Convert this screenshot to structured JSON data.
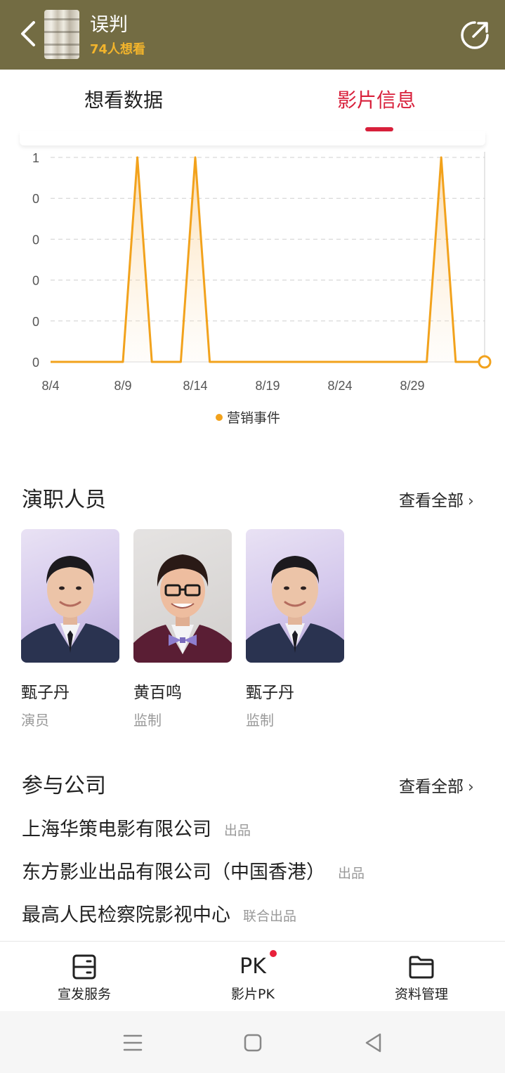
{
  "header": {
    "title": "误判",
    "subtitle": "74人想看",
    "back_icon": "chevron-left-icon",
    "share_icon": "share-icon"
  },
  "tabs": [
    {
      "label": "想看数据",
      "active": false
    },
    {
      "label": "影片信息",
      "active": true
    }
  ],
  "colors": {
    "header_bg": "#736c43",
    "accent": "#d8203b",
    "line": "#f2a21c",
    "subtitle": "#f2b42c"
  },
  "chart_data": {
    "type": "area",
    "x": [
      "8/4",
      "8/5",
      "8/6",
      "8/7",
      "8/8",
      "8/9",
      "8/10",
      "8/11",
      "8/12",
      "8/13",
      "8/14",
      "8/15",
      "8/16",
      "8/17",
      "8/18",
      "8/19",
      "8/20",
      "8/21",
      "8/22",
      "8/23",
      "8/24",
      "8/25",
      "8/26",
      "8/27",
      "8/28",
      "8/29",
      "8/30",
      "8/31",
      "9/1",
      "9/2",
      "9/3"
    ],
    "series": [
      {
        "name": "营销事件",
        "values": [
          0,
          0,
          0,
          0,
          0,
          0,
          1,
          0,
          0,
          0,
          1,
          0,
          0,
          0,
          0,
          0,
          0,
          0,
          0,
          0,
          0,
          0,
          0,
          0,
          0,
          0,
          0,
          1,
          0,
          0,
          0
        ]
      }
    ],
    "xtick_labels": [
      "8/4",
      "8/9",
      "8/14",
      "8/19",
      "8/24",
      "8/29"
    ],
    "ytick_labels": [
      "1",
      "0",
      "0",
      "0",
      "0",
      "0"
    ],
    "ylim": [
      0,
      1
    ],
    "grid": true,
    "legend_position": "bottom-center"
  },
  "cast": {
    "title": "演职人员",
    "see_all": "查看全部",
    "members": [
      {
        "name": "甄子丹",
        "role": "演员"
      },
      {
        "name": "黄百鸣",
        "role": "监制"
      },
      {
        "name": "甄子丹",
        "role": "监制"
      }
    ]
  },
  "companies": {
    "title": "参与公司",
    "see_all": "查看全部",
    "items": [
      {
        "name": "上海华策电影有限公司",
        "role": "出品"
      },
      {
        "name": "东方影业出品有限公司（中国香港）",
        "role": "出品"
      },
      {
        "name": "最高人民检察院影视中心",
        "role": "联合出品"
      }
    ]
  },
  "bottom_bar": [
    {
      "label": "宣发服务",
      "icon": "server-icon"
    },
    {
      "label": "影片PK",
      "icon": "pk-icon",
      "icon_text": "PK",
      "badge": true
    },
    {
      "label": "资料管理",
      "icon": "folder-icon"
    }
  ],
  "system_nav": [
    "menu-icon",
    "home-icon",
    "back-triangle-icon"
  ]
}
